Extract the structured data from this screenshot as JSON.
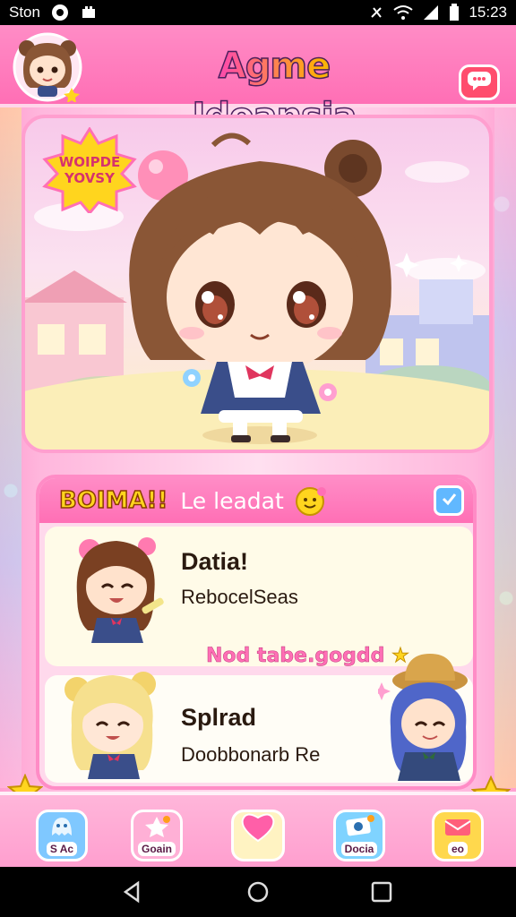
{
  "status_bar": {
    "carrier": "Ston",
    "time": "15:23"
  },
  "header": {
    "title": "Agme Idoansia"
  },
  "hero": {
    "badge_text": "WOIPDE YOVSY"
  },
  "panel": {
    "tag": "BOIMA!!",
    "title": "Le leadat",
    "banner": "Nod tabe.gogdd",
    "items": [
      {
        "name": "Datia!",
        "subtitle": "RebocelSeas"
      },
      {
        "name": "Splrad",
        "subtitle": "Doobbonarb Re"
      }
    ]
  },
  "bottom_nav": {
    "items": [
      {
        "label": "S Ac"
      },
      {
        "label": "Goain"
      },
      {
        "label": ""
      },
      {
        "label": "Docia"
      },
      {
        "label": "eo"
      }
    ]
  },
  "colors": {
    "primary_pink": "#ff6fb5",
    "accent_yellow": "#ffd51e",
    "accent_blue": "#61b8ff"
  }
}
